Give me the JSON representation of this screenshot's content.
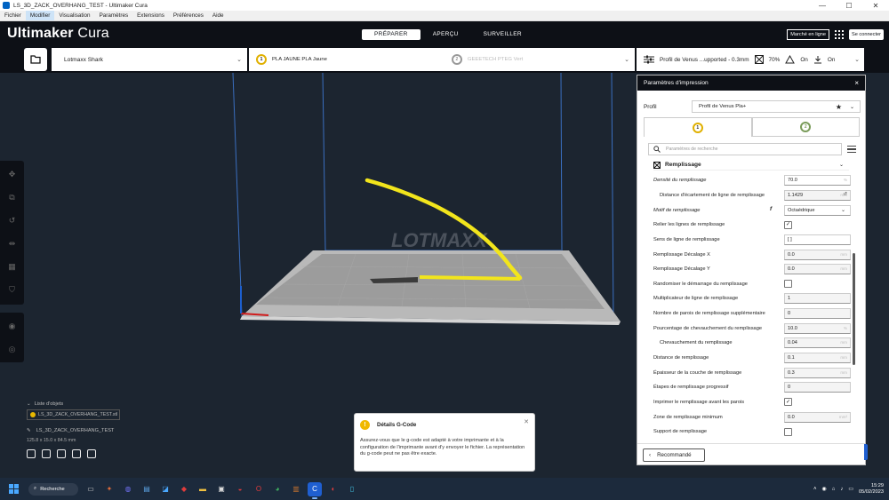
{
  "window": {
    "title": "LS_3D_ZACK_OVERHANG_TEST - Ultimaker Cura",
    "minimize": "—",
    "maximize": "☐",
    "close": "✕"
  },
  "menu": [
    "Fichier",
    "Modifier",
    "Visualisation",
    "Paramètres",
    "Extensions",
    "Préférences",
    "Aide"
  ],
  "header": {
    "brand_bold": "Ultimaker",
    "brand_thin": " Cura",
    "stages": [
      "PRÉPARER",
      "APERÇU",
      "SURVEILLER"
    ],
    "marketplace": "Marché en ligne",
    "signin": "Se connecter"
  },
  "toolbar": {
    "printer": "Lotmaxx Shark",
    "material1_index": "1",
    "material1": "PLA JAUNE PLA Jaune",
    "material2_index": "2",
    "material2": "GEEETECH PTEG Vert",
    "profile": "Profil de Venus ...upported - 0.3mm",
    "infill": "70%",
    "support": "On",
    "adhesion": "On"
  },
  "viewport": {
    "watermark": "LOTMAXX"
  },
  "objects": {
    "header": "Liste d'objets",
    "items": [
      "LS_3D_ZACK_OVERHANG_TEST.stl"
    ],
    "filename": "LS_3D_ZACK_OVERHANG_TEST",
    "dimensions": "125.8 x 15.0 x 84.5 mm"
  },
  "gcode": {
    "title": "Détails G-Code",
    "body": "Assurez-vous que le g-code est adapté à votre imprimante et à la configuration de l'imprimante avant d'y envoyer le fichier. La représentation du g-code peut ne pas être exacte."
  },
  "panel": {
    "title": "Paramètres d'impression",
    "profile_label": "Profil",
    "profile_value": "Profil de Venus Pla+",
    "tab1": "1",
    "tab2": "2",
    "search_placeholder": "Paramètres de recherche",
    "category": "Remplissage",
    "recommended": "Recommandé",
    "settings": [
      {
        "label": "Densité du remplissage",
        "value": "70.0",
        "unit": "%",
        "kind": "input",
        "italic": true
      },
      {
        "label": "Distance d'écartement de ligne de remplissage",
        "value": "1.1429",
        "unit": "mm",
        "kind": "input",
        "indent": true,
        "tint": true
      },
      {
        "label": "Motif de remplissage",
        "value": "Octaédrique",
        "kind": "select",
        "italic": true
      },
      {
        "label": "Relier les lignes de remplissage",
        "checked": true,
        "kind": "check"
      },
      {
        "label": "Sens de ligne de remplissage",
        "value": "[ ]",
        "kind": "input"
      },
      {
        "label": "Remplissage Décalage X",
        "value": "0.0",
        "unit": "mm",
        "kind": "input",
        "tint": true
      },
      {
        "label": "Remplissage Décalage Y",
        "value": "0.0",
        "unit": "mm",
        "kind": "input",
        "tint": true
      },
      {
        "label": "Randomiser le démarrage du remplissage",
        "checked": false,
        "kind": "check"
      },
      {
        "label": "Multiplicateur de ligne de remplissage",
        "value": "1",
        "kind": "input",
        "tint": true
      },
      {
        "label": "Nombre de parois de remplissage supplémentaire",
        "value": "0",
        "kind": "input",
        "tint": true
      },
      {
        "label": "Pourcentage de chevauchement du remplissage",
        "value": "10.0",
        "unit": "%",
        "kind": "input",
        "tint": true
      },
      {
        "label": "Chevauchement du remplissage",
        "value": "0.04",
        "unit": "mm",
        "kind": "input",
        "indent": true,
        "tint": true
      },
      {
        "label": "Distance de remplissage",
        "value": "0.1",
        "unit": "mm",
        "kind": "input",
        "tint": true
      },
      {
        "label": "Épaisseur de la couche de remplissage",
        "value": "0.3",
        "unit": "mm",
        "kind": "input",
        "tint": true
      },
      {
        "label": "Étapes de remplissage progressif",
        "value": "0",
        "kind": "input",
        "tint": true
      },
      {
        "label": "Imprimer le remplissage avant les parois",
        "checked": true,
        "kind": "check"
      },
      {
        "label": "Zone de remplissage minimum",
        "value": "0.0",
        "unit": "mm²",
        "kind": "input",
        "tint": true
      },
      {
        "label": "Support de remplissage",
        "checked": false,
        "kind": "check"
      }
    ]
  },
  "taskbar": {
    "search": "Recherche",
    "time": "15:29",
    "date": "05/02/2023"
  },
  "colors": {
    "dark": "#0d1016",
    "viewport": "#1c2530",
    "model_yellow": "#f2e51c",
    "accent_blue": "#1f5fd1"
  }
}
